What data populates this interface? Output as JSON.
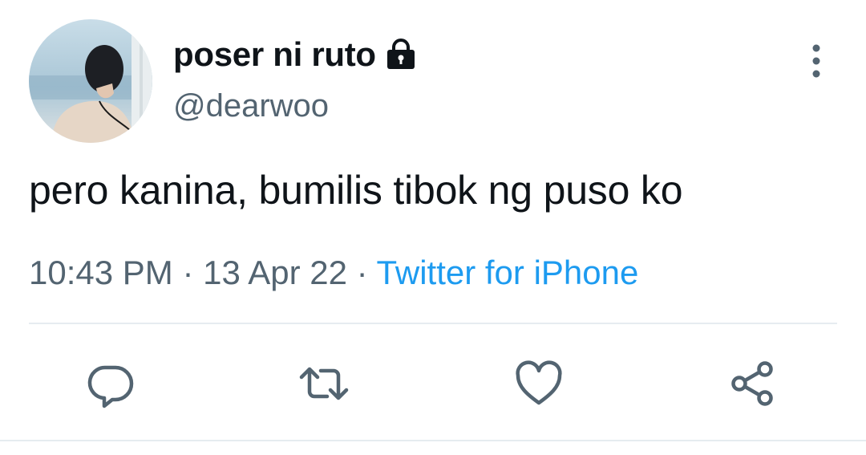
{
  "user": {
    "display_name": "poser ni ruto",
    "handle": "@dearwoo",
    "protected_icon": "lock-icon",
    "avatar_icon": "avatar-photo"
  },
  "tweet": {
    "text": "pero kanina, bumilis tibok ng puso ko",
    "time": "10:43 PM",
    "separator": "·",
    "date": "13 Apr 22",
    "source": "Twitter for iPhone"
  },
  "actions": [
    {
      "icon": "reply-icon"
    },
    {
      "icon": "retweet-icon"
    },
    {
      "icon": "like-icon"
    },
    {
      "icon": "share-icon"
    }
  ],
  "colors": {
    "text": "#0f1419",
    "secondary": "#536471",
    "link": "#1d9bf0",
    "divider": "#e6ecf0"
  }
}
